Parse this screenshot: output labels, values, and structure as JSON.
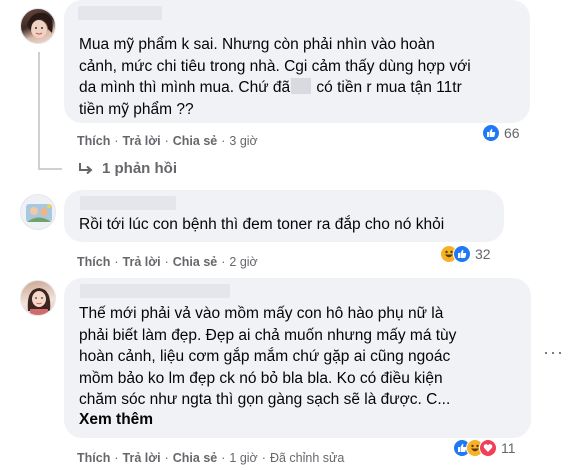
{
  "comments": [
    {
      "lines": [
        "Mua mỹ phẩm k sai. Nhưng còn phải nhìn vào hoàn",
        "cảnh, mức chi tiêu trong nhà. Cgi cảm thấy dùng hợp với",
        "da mình thì mình mua. Chứ đã",
        " có tiền r mua tận 11tr",
        "tiền mỹ phẩm ??"
      ],
      "like_label": "Thích",
      "reply_label": "Trả lời",
      "share_label": "Chia sẻ",
      "time": "3 giờ",
      "reaction_count": "66",
      "reactions": [
        "like-icon"
      ]
    },
    {
      "text": "Rồi tới lúc con bệnh thì đem toner ra đắp cho nó khỏi",
      "like_label": "Thích",
      "reply_label": "Trả lời",
      "share_label": "Chia sẻ",
      "time": "2 giờ",
      "reaction_count": "32",
      "reactions": [
        "haha-icon",
        "like-icon"
      ]
    },
    {
      "text": "Thế mới phải vả vào mồm mấy con hô hào phụ nữ là\nphải biết làm đẹp. Đẹp ai chả muốn nhưng mấy má tùy\nhoàn cảnh, liệu cơm gắp mắm chứ gặp ai cũng ngoác\nmồm bảo ko lm đẹp ck nó bỏ bla bla. Ko có điều kiện\nchăm sóc như ngta thì gọn gàng sạch sẽ là được. C...",
      "see_more": "Xem thêm",
      "like_label": "Thích",
      "reply_label": "Trả lời",
      "share_label": "Chia sẻ",
      "time": "1 giờ",
      "edited": "Đã chỉnh sửa",
      "reaction_count": "11",
      "reactions": [
        "like-icon",
        "haha-icon",
        "love-icon"
      ]
    }
  ],
  "reply_thread": {
    "label": "1 phản hồi"
  },
  "colors": {
    "bubble": "#f0f2f5",
    "secondary_text": "#65676b",
    "like_blue": "#2078f4"
  }
}
